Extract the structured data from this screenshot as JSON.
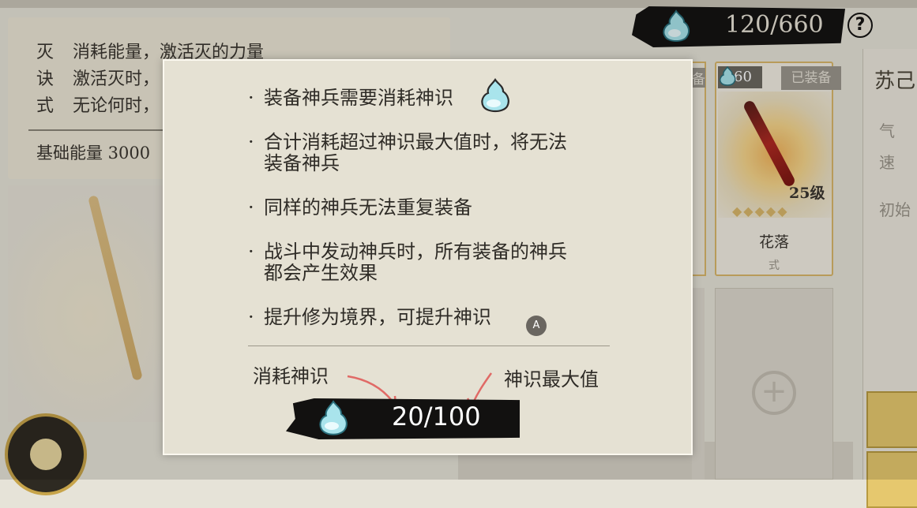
{
  "background": {
    "info_rows": [
      {
        "key": "灭",
        "value": "消耗能量，激活灭的力量"
      },
      {
        "key": "诀",
        "value": "激活灭时，"
      },
      {
        "key": "式",
        "value": "无论何时，"
      }
    ],
    "base_energy": "基础能量 3000",
    "resource_value": "120/660",
    "help_label": "?",
    "card": {
      "cost": "60",
      "equipped_label": "已装备",
      "level": "25级",
      "name": "花落",
      "type": "式",
      "stars": 5
    },
    "strip_fragment": "备",
    "right_panel": {
      "name": "苏己",
      "hints": [
        "气",
        "速",
        "初始"
      ]
    }
  },
  "modal": {
    "rules": [
      "装备神兵需要消耗神识",
      "合计消耗超过神识最大值时，将无法",
      "装备神兵",
      "同样的神兵无法重复装备",
      "战斗中发动神兵时，所有装备的神兵",
      "都会产生效果",
      "提升修为境界，可提升神识"
    ],
    "bullet": "·",
    "button_hint": "A",
    "label_consume": "消耗神识",
    "label_max": "神识最大值",
    "example_value": "20/100"
  },
  "colors": {
    "modal_bg": "#e5e1d3",
    "bar_bg": "#121110",
    "gem": "#7fd3e0",
    "arrow": "#e06a66",
    "gold": "#d9b76a"
  },
  "icons": [
    "spirit-gem-icon",
    "help-icon",
    "plus-icon",
    "arrow-icon",
    "a-button-icon"
  ]
}
